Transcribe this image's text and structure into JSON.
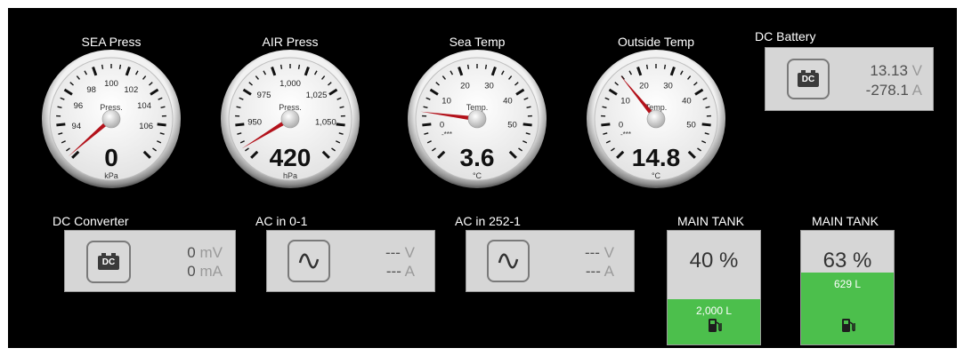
{
  "gauges": [
    {
      "title": "SEA Press",
      "label": "Press.",
      "value": "0",
      "unit": "kPa",
      "ticks": [
        "94",
        "96",
        "98",
        "100",
        "102",
        "104",
        "106"
      ],
      "needle_value": 93.2,
      "range": [
        93,
        107
      ],
      "asterisk": ""
    },
    {
      "title": "AIR Press",
      "label": "Press.",
      "value": "420",
      "unit": "hPa",
      "ticks": [
        "950",
        "975",
        "1,000",
        "1,025",
        "1,050"
      ],
      "needle_value": 946,
      "range": [
        940,
        1060
      ],
      "asterisk": ""
    },
    {
      "title": "Sea Temp",
      "label": "Temp.",
      "value": "3.6",
      "unit": "°C",
      "ticks": [
        "0",
        "10",
        "20",
        "30",
        "40",
        "50"
      ],
      "needle_value": 3.6,
      "range": [
        -10,
        60
      ],
      "asterisk": "-***"
    },
    {
      "title": "Outside Temp",
      "label": "Temp.",
      "value": "14.8",
      "unit": "°C",
      "ticks": [
        "0",
        "10",
        "20",
        "30",
        "40",
        "50"
      ],
      "needle_value": 14.8,
      "range": [
        -10,
        60
      ],
      "asterisk": "-***"
    }
  ],
  "dc_battery": {
    "title": "DC Battery",
    "icon_text": "DC",
    "voltage": "13.13",
    "voltage_unit": "V",
    "current": "-278.1",
    "current_unit": "A"
  },
  "dc_converter": {
    "title": "DC Converter",
    "icon_text": "DC",
    "voltage": "0",
    "voltage_unit": "mV",
    "current": "0",
    "current_unit": "mA"
  },
  "ac_inputs": [
    {
      "title": "AC in 0-1",
      "voltage": "---",
      "voltage_unit": "V",
      "current": "---",
      "current_unit": "A"
    },
    {
      "title": "AC in 252-1",
      "voltage": "---",
      "voltage_unit": "V",
      "current": "---",
      "current_unit": "A"
    }
  ],
  "tanks": [
    {
      "title": "MAIN TANK",
      "percent": "40 %",
      "level": 0.4,
      "volume": "2,000 L"
    },
    {
      "title": "MAIN TANK",
      "percent": "63 %",
      "level": 0.63,
      "volume": "629 L"
    }
  ],
  "colors": {
    "background": "#000000",
    "panel": "#d6d6d6",
    "fill": "#4cbf4c",
    "needle": "#b3121b",
    "text": "#ffffff"
  }
}
